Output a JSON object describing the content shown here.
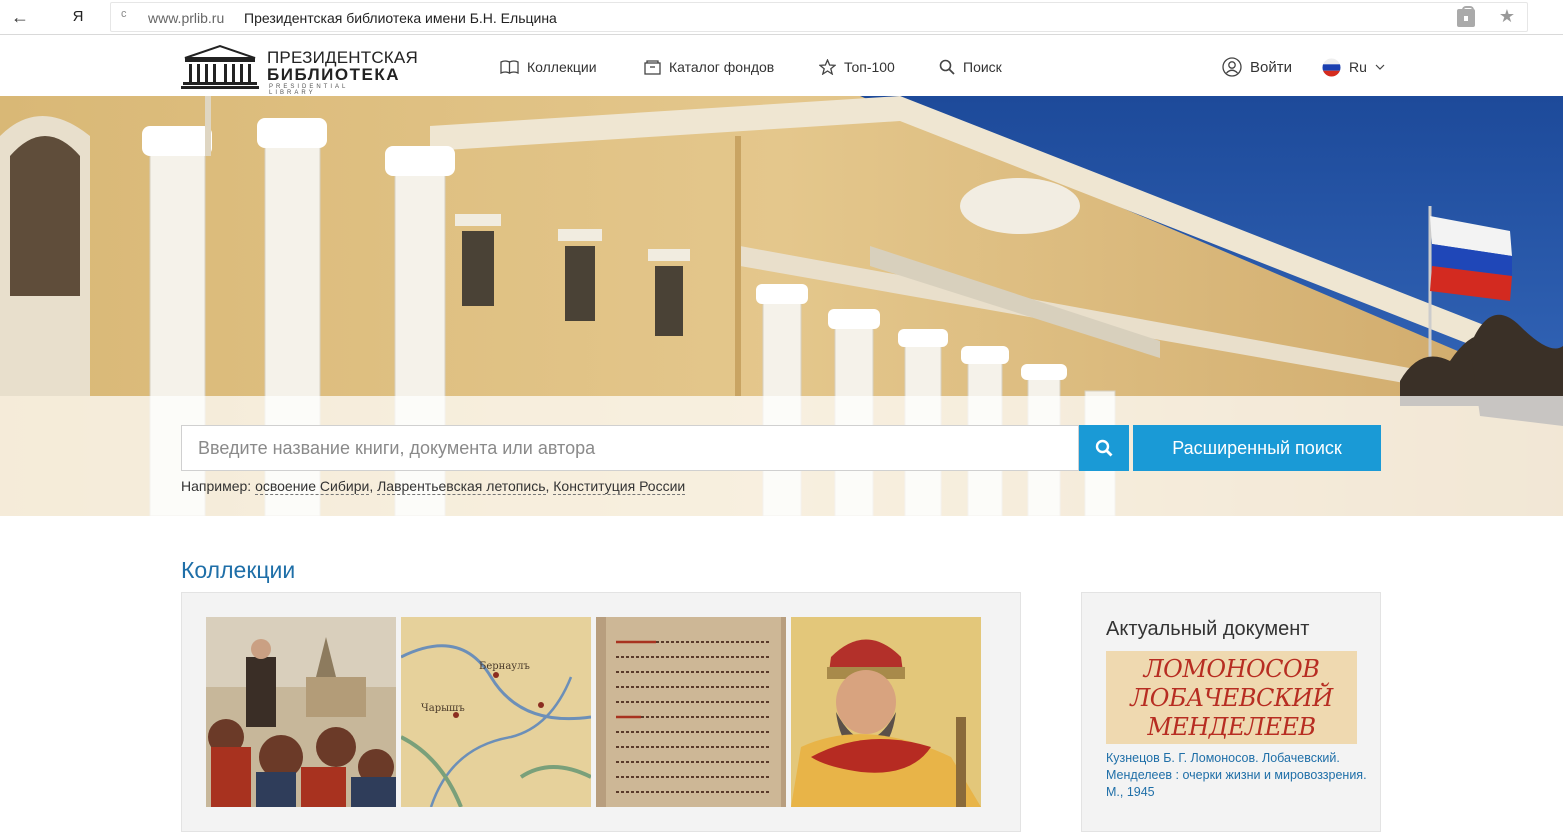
{
  "browser": {
    "back_glyph": "←",
    "yandex_glyph": "Я",
    "reload_glyph": "c",
    "url_domain": "www.prlib.ru",
    "page_title": "Президентская библиотека имени Б.Н. Ельцина",
    "icons": [
      "back-arrow-icon",
      "yandex-icon",
      "reload-icon",
      "lock-icon",
      "bookmark-star-icon"
    ]
  },
  "header": {
    "logo": {
      "line1": "ПРЕЗИДЕНТСКАЯ",
      "line2": "БИБЛИОТЕКА",
      "line3": "PRESIDENTIAL LIBRARY"
    },
    "nav": {
      "collections": "Коллекции",
      "catalog": "Каталог фондов",
      "top100": "Топ-100",
      "search": "Поиск",
      "login": "Войти",
      "language": "Ru"
    }
  },
  "hero": {
    "search_placeholder": "Введите название книги, документа или автора",
    "advanced_search": "Расширенный поиск",
    "examples_label": "Например:",
    "examples": [
      "освоение Сибири",
      "Лаврентьевская летопись",
      "Конституция России"
    ]
  },
  "collections": {
    "title": "Коллекции"
  },
  "actual_document": {
    "title": "Актуальный документ",
    "cover_lines": [
      "ЛОМОНОСОВ",
      "ЛОБАЧЕВСКИЙ",
      "МЕНДЕЛЕЕВ"
    ],
    "link_text": "Кузнецов Б. Г. Ломоносов. Лобачевский. Менделеев : очерки жизни и мировоззрения. М., 1945"
  },
  "colors": {
    "accent": "#1a9ad6",
    "link": "#1f6fa8",
    "cover_text": "#b72d22"
  }
}
